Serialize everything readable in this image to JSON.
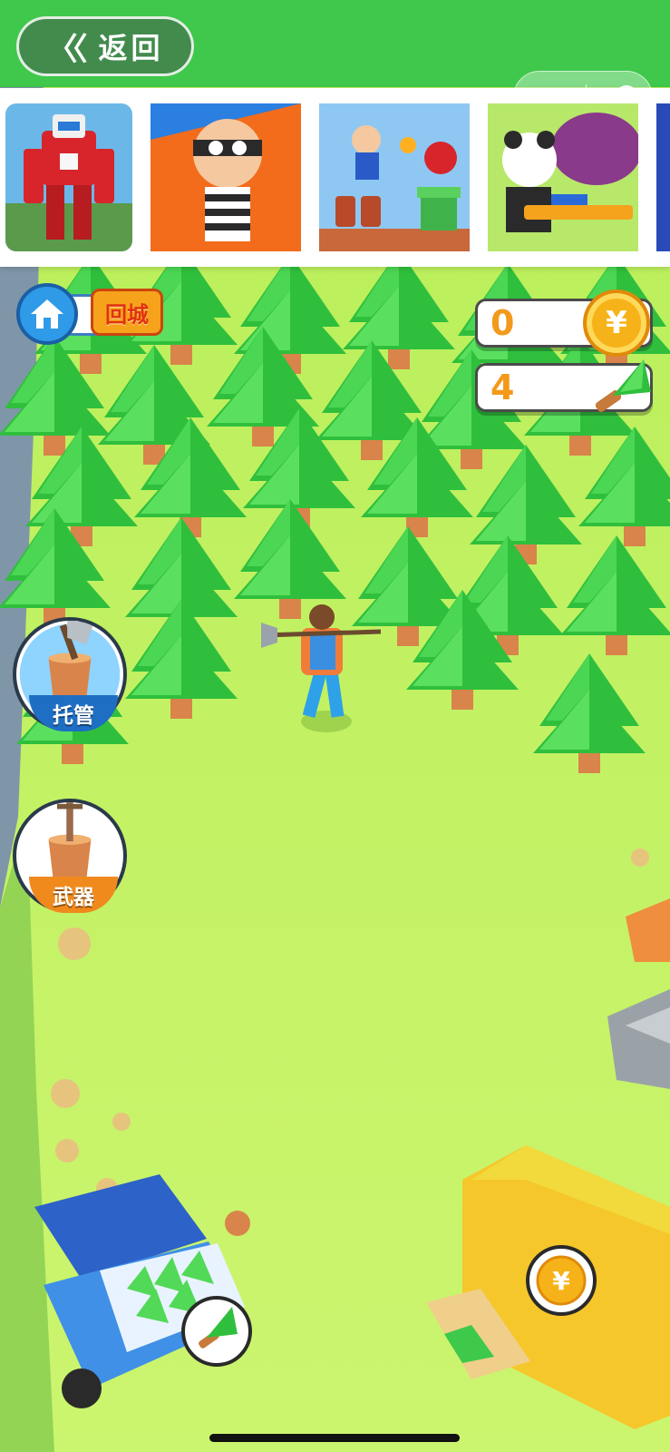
{
  "nav": {
    "back_label": "返回",
    "back_icon": "double-chevron-left-icon"
  },
  "capsule": {
    "more_icon": "more-dots-icon",
    "close_icon": "target-circle-icon"
  },
  "ad_strip": {
    "thumbnails": [
      {
        "name": "robot-hero-game"
      },
      {
        "name": "thief-escape-game"
      },
      {
        "name": "platformer-hero-game"
      },
      {
        "name": "panda-shooter-game"
      }
    ]
  },
  "hud": {
    "home_icon": "house-icon",
    "return_town_label": "回城",
    "coins": {
      "value": "0",
      "icon": "yuan-coin-icon"
    },
    "wood": {
      "value": "4",
      "icon": "pine-tree-icon"
    }
  },
  "side_buttons": {
    "auto": {
      "label": "托管",
      "icon": "axe-in-stump-icon"
    },
    "weapon": {
      "label": "武器",
      "icon": "sword-in-stump-icon"
    }
  },
  "colors": {
    "grass": "#c6f36b",
    "tree": "#52d957",
    "accent_orange": "#f39a1c",
    "ui_blue": "#2f9be8"
  }
}
